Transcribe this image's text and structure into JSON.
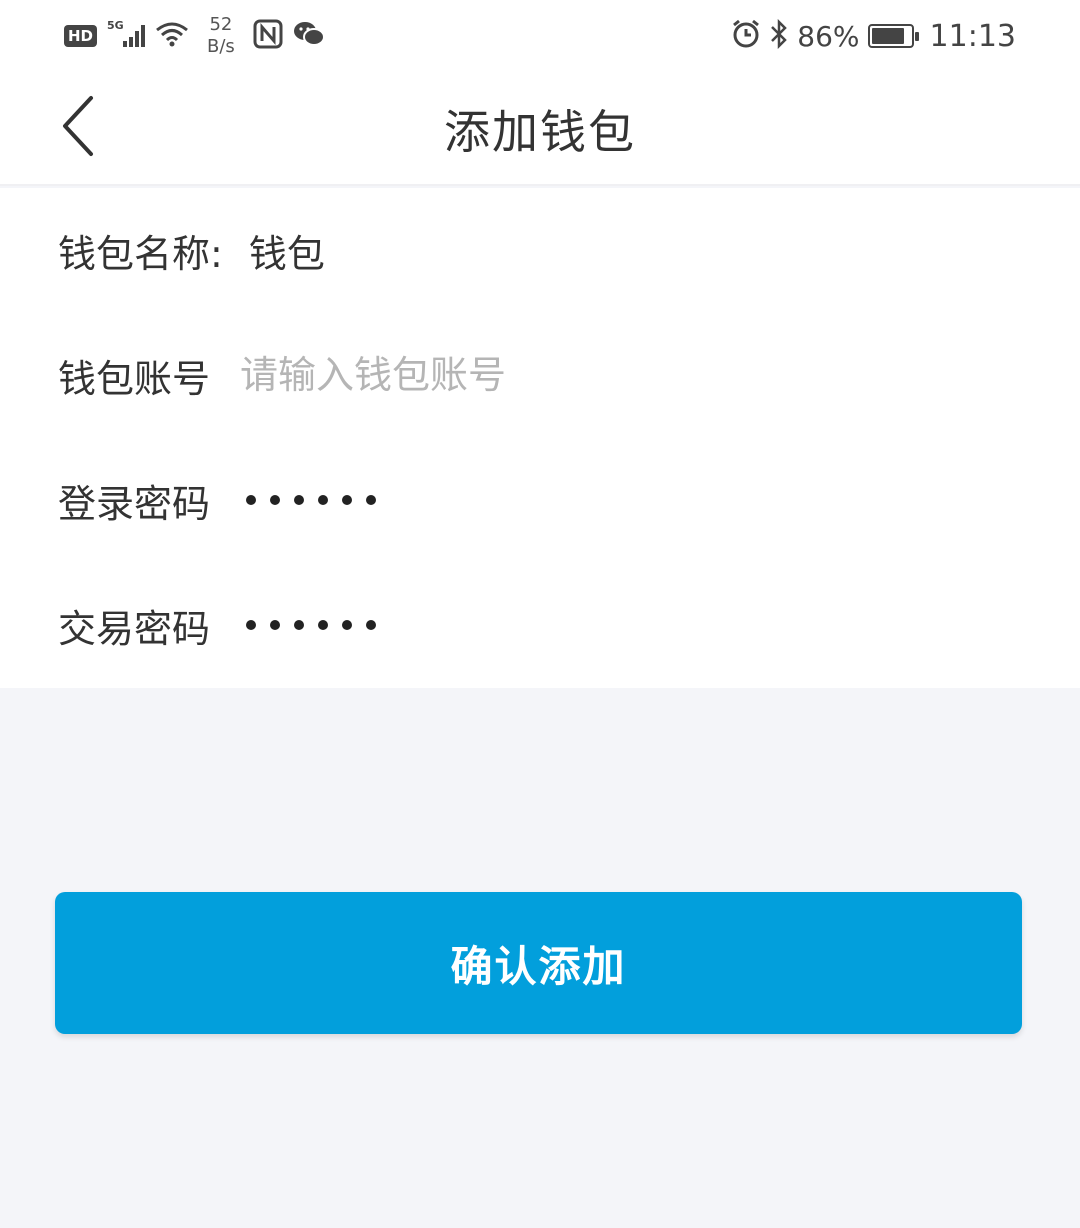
{
  "status_bar": {
    "hd_label": "HD",
    "signal_label": "5G",
    "net_speed_value": "52",
    "net_speed_unit": "B/s",
    "battery_percent": "86%",
    "battery_level": 0.86,
    "time": "11:13"
  },
  "header": {
    "title": "添加钱包",
    "back_icon": "chevron-left-icon"
  },
  "form": {
    "wallet_name_label": "钱包名称:",
    "wallet_name_value": "钱包",
    "wallet_account_label": "钱包账号",
    "wallet_account_placeholder": "请输入钱包账号",
    "login_password_label": "登录密码",
    "transaction_password_label": "交易密码"
  },
  "actions": {
    "confirm_label": "确认添加"
  },
  "colors": {
    "accent": "#029fdc",
    "background": "#f4f5f9"
  }
}
